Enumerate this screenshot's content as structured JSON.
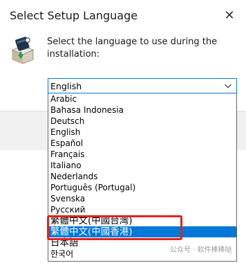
{
  "window": {
    "title": "Select Setup Language",
    "close_glyph": "✕"
  },
  "prompt": "Select the language to use during the installation:",
  "select": {
    "selected_value": "English"
  },
  "languages": [
    "Arabic",
    "Bahasa Indonesia",
    "Deutsch",
    "English",
    "Español",
    "Français",
    "Italiano",
    "Nederlands",
    "Português (Portugal)",
    "Svenska",
    "Русский",
    "繁體中文(中國台灣)",
    "繁體中文(中國香港)",
    "日本語",
    "한국어"
  ],
  "highlighted_index": 12,
  "watermark": "公众号 · 软件棒棒哒",
  "colors": {
    "selection": "#0078d7",
    "annotation_box": "#e2231a"
  },
  "icons": {
    "setup": "setup-box-icon",
    "close": "close-icon",
    "dropdown": "chevron-down-icon"
  }
}
